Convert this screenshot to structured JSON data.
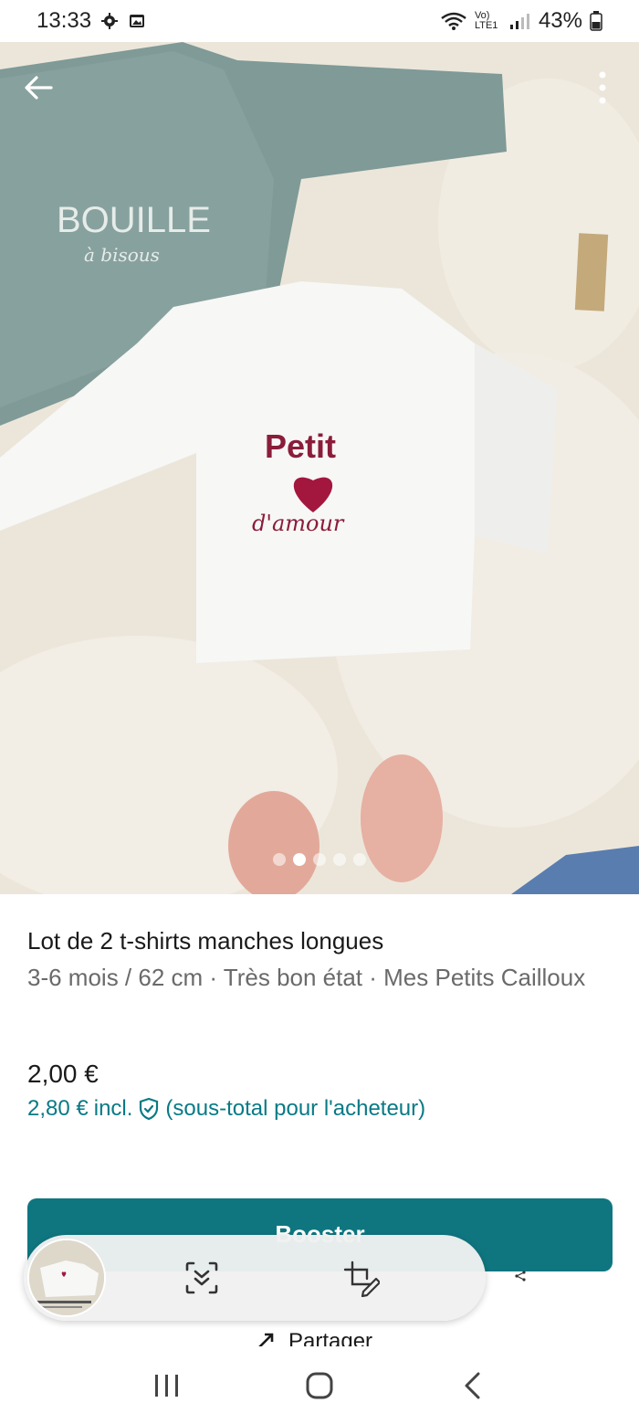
{
  "status_bar": {
    "time": "13:33",
    "battery": "43%",
    "network": "Vo) LTE1"
  },
  "listing": {
    "title": "Lot de 2 t-shirts manches longues",
    "meta": "3-6 mois / 62 cm · Très bon état · Mes Petits Cailloux",
    "price": "2,00 €",
    "price_incl_amount": "2,80 €",
    "price_incl_word": "incl.",
    "price_incl_note": "(sous-total pour l'acheteur)"
  },
  "photo": {
    "page_count": 5,
    "active_index": 1,
    "shirt_back_text": "BOUILLE",
    "shirt_back_subtext": "à bisous",
    "shirt_front_text": "Petit",
    "shirt_front_subtext": "d'amour"
  },
  "actions": {
    "booster_label": "Booster",
    "share_label": "Partager"
  },
  "colors": {
    "accent": "#0f7680",
    "link": "#087a85"
  },
  "icons": {
    "back": "arrow-left-icon",
    "more": "more-vertical-icon",
    "scan": "scroll-capture-icon",
    "edit": "crop-edit-icon",
    "share": "share-icon"
  }
}
